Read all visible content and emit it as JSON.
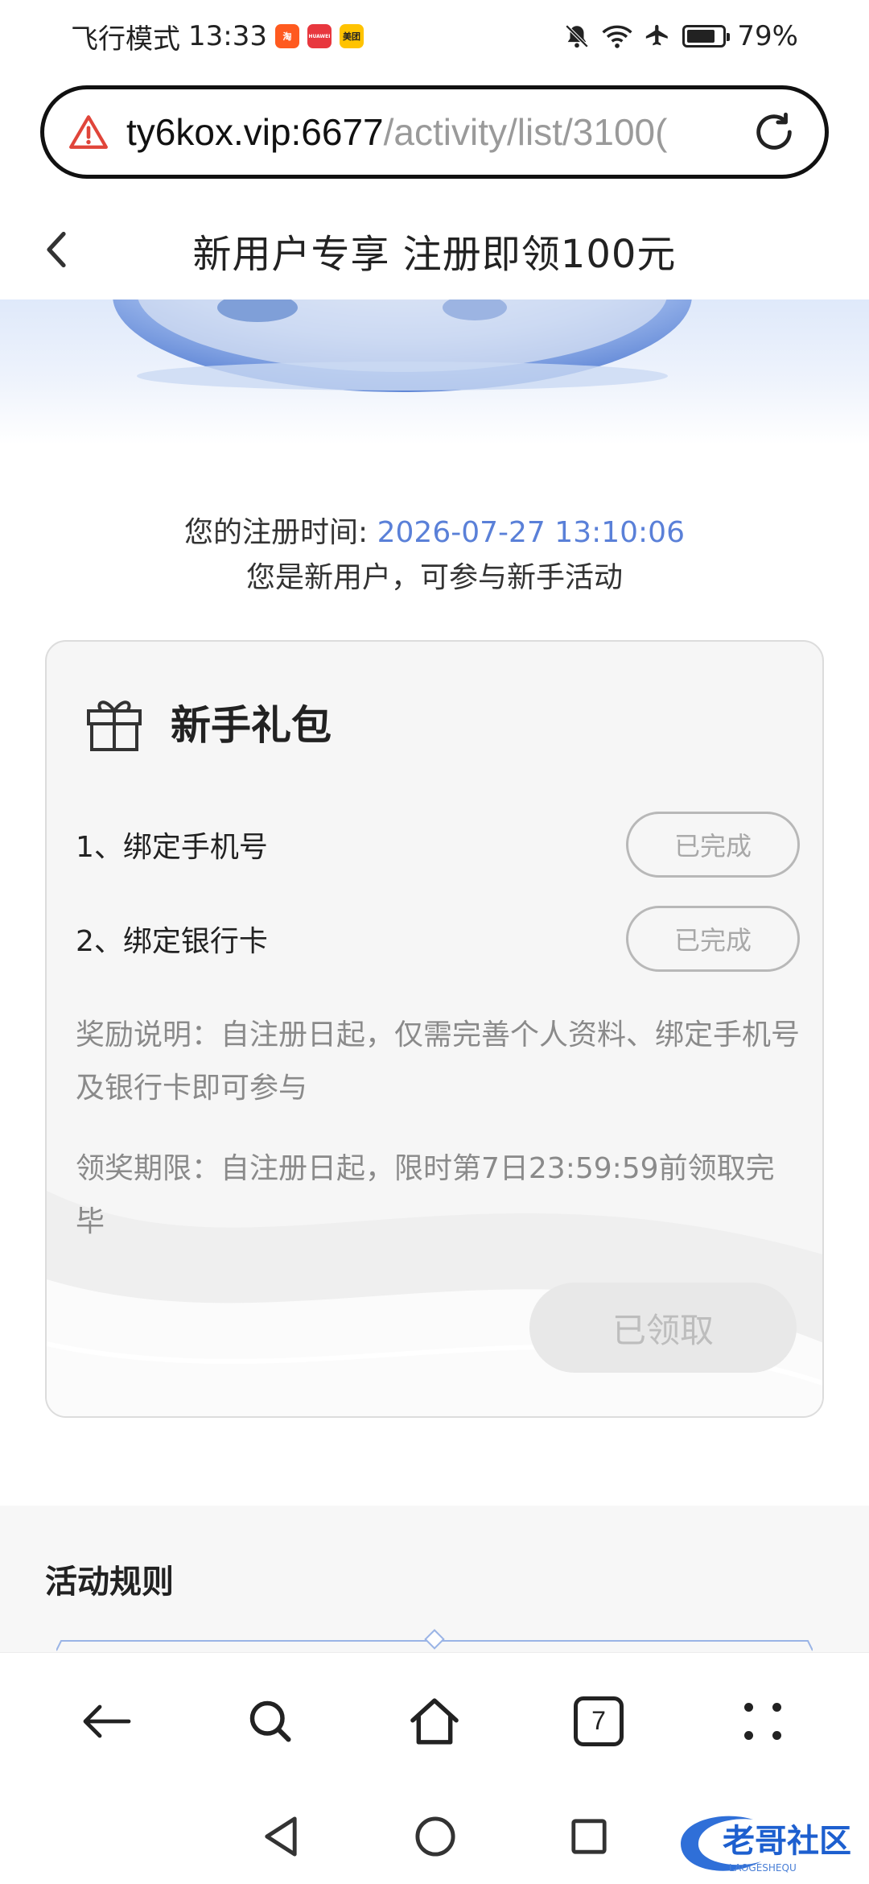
{
  "status_bar": {
    "mode_label": "飞行模式",
    "time": "13:33",
    "battery_percent": "79%",
    "battery_level": 0.79,
    "app_badges": [
      {
        "name": "taobao-badge",
        "text": "淘",
        "color": "#ff5a1f"
      },
      {
        "name": "huawei-badge",
        "text": "HUAWEI",
        "color": "#e8373e"
      },
      {
        "name": "meituan-badge",
        "text": "美团",
        "color": "#ffc300"
      }
    ]
  },
  "browser": {
    "url_host": "ty6kox.vip:6677",
    "url_path": "/activity/list/3100(",
    "tab_count": "7"
  },
  "page": {
    "title": "新用户专享 注册即领100元"
  },
  "registration": {
    "label": "您的注册时间:",
    "time_value": "2026-07-27 13:10:06",
    "message": "您是新用户，可参与新手活动"
  },
  "gift_card": {
    "title": "新手礼包",
    "tasks": [
      {
        "label": "1、绑定手机号",
        "status": "已完成"
      },
      {
        "label": "2、绑定银行卡",
        "status": "已完成"
      }
    ],
    "reward_note": "奖励说明：自注册日起，仅需完善个人资料、绑定手机号及银行卡即可参与",
    "deadline_note": "领奖期限：自注册日起，限时第7日23:59:59前领取完毕",
    "claim_button": "已领取"
  },
  "rules": {
    "title": "活动规则"
  },
  "watermark": {
    "text": "老哥社区",
    "subtext": "LAOGESHEQU"
  },
  "colors": {
    "accent_blue": "#5a80d8",
    "warning_red": "#e0453a",
    "disabled_gray": "#a8a8a8"
  }
}
